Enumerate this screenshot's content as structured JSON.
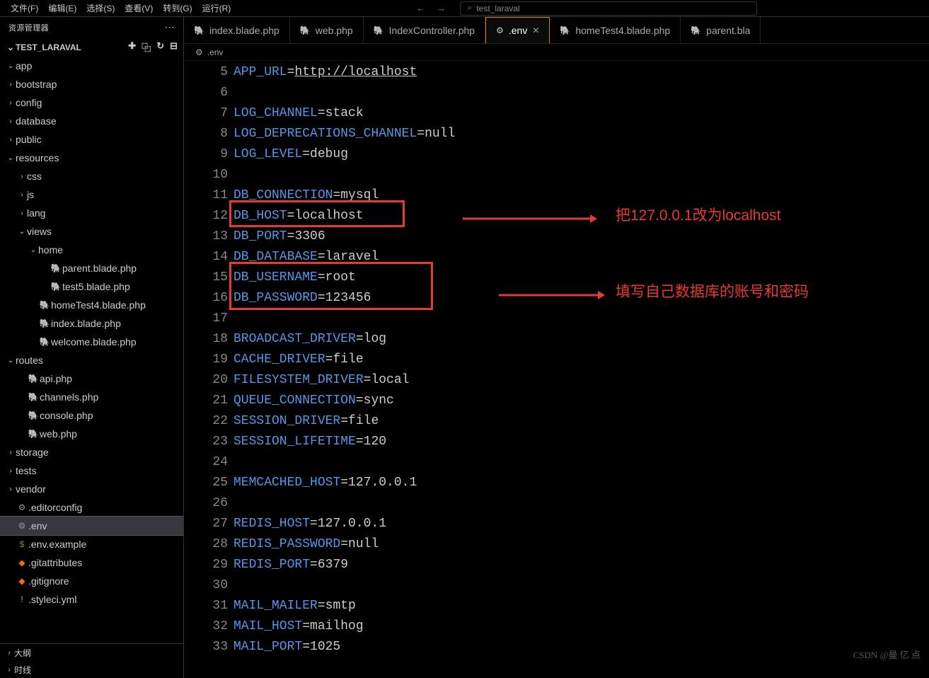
{
  "menubar": [
    "文件(F)",
    "编辑(E)",
    "选择(S)",
    "查看(V)",
    "转到(G)",
    "运行(R)"
  ],
  "search": {
    "placeholder": "test_laraval",
    "icon": "⌕"
  },
  "sidebar": {
    "title": "资源管理器",
    "project": "TEST_LARAVAL",
    "tree": [
      {
        "d": 0,
        "t": "folder",
        "open": true,
        "lbl": "app"
      },
      {
        "d": 0,
        "t": "folder",
        "open": false,
        "lbl": "bootstrap"
      },
      {
        "d": 0,
        "t": "folder",
        "open": false,
        "lbl": "config"
      },
      {
        "d": 0,
        "t": "folder",
        "open": false,
        "lbl": "database"
      },
      {
        "d": 0,
        "t": "folder",
        "open": false,
        "lbl": "public"
      },
      {
        "d": 0,
        "t": "folder",
        "open": true,
        "lbl": "resources"
      },
      {
        "d": 1,
        "t": "folder",
        "open": false,
        "lbl": "css"
      },
      {
        "d": 1,
        "t": "folder",
        "open": false,
        "lbl": "js"
      },
      {
        "d": 1,
        "t": "folder",
        "open": false,
        "lbl": "lang"
      },
      {
        "d": 1,
        "t": "folder",
        "open": true,
        "lbl": "views"
      },
      {
        "d": 2,
        "t": "folder",
        "open": true,
        "lbl": "home"
      },
      {
        "d": 3,
        "t": "php",
        "lbl": "parent.blade.php"
      },
      {
        "d": 3,
        "t": "php",
        "lbl": "test5.blade.php"
      },
      {
        "d": 2,
        "t": "php",
        "lbl": "homeTest4.blade.php"
      },
      {
        "d": 2,
        "t": "php",
        "lbl": "index.blade.php"
      },
      {
        "d": 2,
        "t": "php",
        "lbl": "welcome.blade.php"
      },
      {
        "d": 0,
        "t": "folder",
        "open": true,
        "lbl": "routes"
      },
      {
        "d": 1,
        "t": "php",
        "lbl": "api.php"
      },
      {
        "d": 1,
        "t": "php",
        "lbl": "channels.php"
      },
      {
        "d": 1,
        "t": "php",
        "lbl": "console.php"
      },
      {
        "d": 1,
        "t": "php",
        "lbl": "web.php"
      },
      {
        "d": 0,
        "t": "folder",
        "open": false,
        "lbl": "storage"
      },
      {
        "d": 0,
        "t": "folder",
        "open": false,
        "lbl": "tests"
      },
      {
        "d": 0,
        "t": "folder",
        "open": false,
        "lbl": "vendor"
      },
      {
        "d": 0,
        "t": "gear",
        "lbl": ".editorconfig"
      },
      {
        "d": 0,
        "t": "gear",
        "lbl": ".env",
        "sel": true
      },
      {
        "d": 0,
        "t": "env",
        "lbl": ".env.example"
      },
      {
        "d": 0,
        "t": "git",
        "lbl": ".gitattributes"
      },
      {
        "d": 0,
        "t": "git",
        "lbl": ".gitignore"
      },
      {
        "d": 0,
        "t": "sty",
        "lbl": ".styleci.yml"
      }
    ],
    "bottom": [
      "大纲",
      "时线"
    ]
  },
  "tabs": [
    {
      "icon": "php",
      "lbl": "index.blade.php"
    },
    {
      "icon": "php",
      "lbl": "web.php"
    },
    {
      "icon": "php",
      "lbl": "IndexController.php"
    },
    {
      "icon": "gear",
      "lbl": ".env",
      "active": true,
      "close": true
    },
    {
      "icon": "php",
      "lbl": "homeTest4.blade.php"
    },
    {
      "icon": "php",
      "lbl": "parent.bla"
    }
  ],
  "crumbs": {
    "icon": "⚙",
    "file": ".env"
  },
  "lines": [
    {
      "n": 5,
      "k": "APP_URL",
      "v": "http://localhost",
      "u": true
    },
    {
      "n": 6
    },
    {
      "n": 7,
      "k": "LOG_CHANNEL",
      "v": "stack"
    },
    {
      "n": 8,
      "k": "LOG_DEPRECATIONS_CHANNEL",
      "v": "null"
    },
    {
      "n": 9,
      "k": "LOG_LEVEL",
      "v": "debug"
    },
    {
      "n": 10
    },
    {
      "n": 11,
      "k": "DB_CONNECTION",
      "v": "mysql"
    },
    {
      "n": 12,
      "k": "DB_HOST",
      "v": "localhost"
    },
    {
      "n": 13,
      "k": "DB_PORT",
      "v": "3306"
    },
    {
      "n": 14,
      "k": "DB_DATABASE",
      "v": "laravel"
    },
    {
      "n": 15,
      "k": "DB_USERNAME",
      "v": "root"
    },
    {
      "n": 16,
      "k": "DB_PASSWORD",
      "v": "123456"
    },
    {
      "n": 17
    },
    {
      "n": 18,
      "k": "BROADCAST_DRIVER",
      "v": "log"
    },
    {
      "n": 19,
      "k": "CACHE_DRIVER",
      "v": "file"
    },
    {
      "n": 20,
      "k": "FILESYSTEM_DRIVER",
      "v": "local"
    },
    {
      "n": 21,
      "k": "QUEUE_CONNECTION",
      "v": "sync"
    },
    {
      "n": 22,
      "k": "SESSION_DRIVER",
      "v": "file"
    },
    {
      "n": 23,
      "k": "SESSION_LIFETIME",
      "v": "120"
    },
    {
      "n": 24
    },
    {
      "n": 25,
      "k": "MEMCACHED_HOST",
      "v": "127.0.0.1"
    },
    {
      "n": 26
    },
    {
      "n": 27,
      "k": "REDIS_HOST",
      "v": "127.0.0.1"
    },
    {
      "n": 28,
      "k": "REDIS_PASSWORD",
      "v": "null"
    },
    {
      "n": 29,
      "k": "REDIS_PORT",
      "v": "6379"
    },
    {
      "n": 30
    },
    {
      "n": 31,
      "k": "MAIL_MAILER",
      "v": "smtp"
    },
    {
      "n": 32,
      "k": "MAIL_HOST",
      "v": "mailhog"
    },
    {
      "n": 33,
      "k": "MAIL_PORT",
      "v": "1025"
    }
  ],
  "annotations": {
    "a1": "把127.0.0.1改为localhost",
    "a2": "填写自己数据库的账号和密码"
  },
  "watermark": "CSDN @曼 亿 点"
}
